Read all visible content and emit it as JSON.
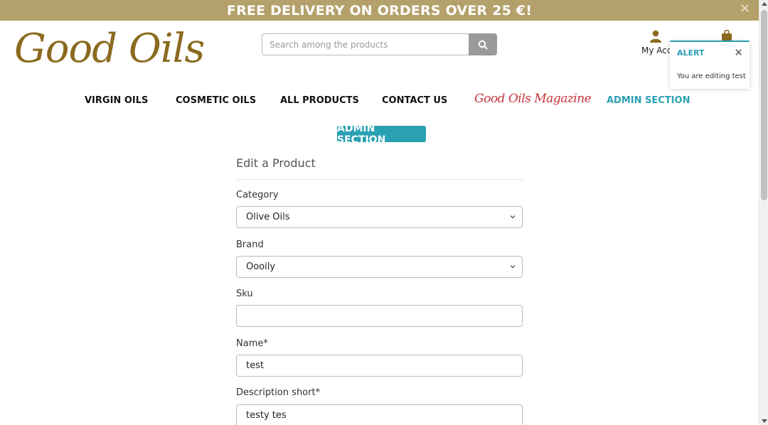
{
  "banner": {
    "text": "FREE DELIVERY ON ORDERS OVER 25 €!",
    "close_icon": "close-icon"
  },
  "logo": {
    "text": "Good Oils"
  },
  "search": {
    "placeholder": "Search among the products",
    "icon": "search-icon"
  },
  "account": {
    "label": "My Acc",
    "icon": "user-icon"
  },
  "bag": {
    "icon": "shopping-bag-icon"
  },
  "alert": {
    "title": "ALERT",
    "message": "You are editing test",
    "close": "✕"
  },
  "nav": {
    "items": [
      {
        "label": "VIRGIN OILS"
      },
      {
        "label": "COSMETIC OILS"
      },
      {
        "label": "ALL PRODUCTS"
      },
      {
        "label": "CONTACT US"
      }
    ],
    "magazine": "Good Oils Magazine",
    "admin": "ADMIN SECTION"
  },
  "admin_badge": "ADMIN SECTION",
  "form": {
    "title": "Edit a Product",
    "fields": [
      {
        "label": "Category",
        "value": "Olive Oils",
        "type": "select"
      },
      {
        "label": "Brand",
        "value": "Oooily",
        "type": "select"
      },
      {
        "label": "Sku",
        "value": "",
        "type": "text"
      },
      {
        "label": "Name*",
        "value": "test",
        "type": "text"
      },
      {
        "label": "Description short*",
        "value": "testy tes",
        "type": "text"
      }
    ]
  },
  "colors": {
    "banner": "#b3a06b",
    "brand": "#8a6a1f",
    "accent": "#2aa1b3",
    "magazine": "#c8333a"
  }
}
